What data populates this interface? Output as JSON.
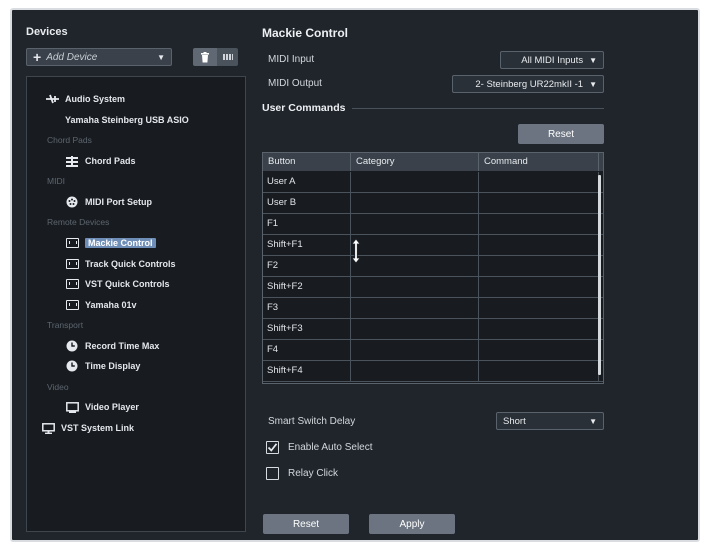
{
  "devices_panel": {
    "title": "Devices",
    "add_device_placeholder": "Add Device",
    "tree": [
      {
        "type": "item",
        "label": "Audio System",
        "icon": "audio-system-icon"
      },
      {
        "type": "item",
        "label": "Yamaha Steinberg USB ASIO",
        "icon": "none",
        "sub": true
      },
      {
        "type": "category",
        "label": "Chord Pads"
      },
      {
        "type": "item",
        "label": "Chord Pads",
        "icon": "chord-pads-icon"
      },
      {
        "type": "category",
        "label": "MIDI"
      },
      {
        "type": "item",
        "label": "MIDI Port Setup",
        "icon": "midi-port-icon"
      },
      {
        "type": "category",
        "label": "Remote Devices"
      },
      {
        "type": "item",
        "label": "Mackie Control",
        "icon": "midi-device-icon",
        "selected": true
      },
      {
        "type": "item",
        "label": "Track Quick Controls",
        "icon": "midi-device-icon"
      },
      {
        "type": "item",
        "label": "VST Quick Controls",
        "icon": "midi-device-icon"
      },
      {
        "type": "item",
        "label": "Yamaha 01v",
        "icon": "midi-device-icon"
      },
      {
        "type": "category",
        "label": "Transport"
      },
      {
        "type": "item",
        "label": "Record Time Max",
        "icon": "clock-icon"
      },
      {
        "type": "item",
        "label": "Time Display",
        "icon": "clock-icon"
      },
      {
        "type": "category",
        "label": "Video"
      },
      {
        "type": "item",
        "label": "Video Player",
        "icon": "video-player-icon"
      },
      {
        "type": "item",
        "label": "VST System Link",
        "icon": "monitor-icon",
        "root": true
      }
    ]
  },
  "device_panel": {
    "title": "Mackie Control",
    "midi_input_label": "MIDI Input",
    "midi_input_value": "All MIDI Inputs",
    "midi_output_label": "MIDI Output",
    "midi_output_value": "2- Steinberg UR22mkII -1",
    "user_commands_title": "User Commands",
    "reset_top_label": "Reset",
    "table": {
      "headers": [
        "Button",
        "Category",
        "Command"
      ],
      "rows": [
        [
          "User A",
          "",
          ""
        ],
        [
          "User B",
          "",
          ""
        ],
        [
          "F1",
          "",
          ""
        ],
        [
          "Shift+F1",
          "",
          ""
        ],
        [
          "F2",
          "",
          ""
        ],
        [
          "Shift+F2",
          "",
          ""
        ],
        [
          "F3",
          "",
          ""
        ],
        [
          "Shift+F3",
          "",
          ""
        ],
        [
          "F4",
          "",
          ""
        ],
        [
          "Shift+F4",
          "",
          ""
        ]
      ]
    },
    "smart_switch_label": "Smart Switch Delay",
    "smart_switch_value": "Short",
    "enable_auto_select_label": "Enable Auto Select",
    "enable_auto_select_checked": true,
    "relay_click_label": "Relay Click",
    "relay_click_checked": false,
    "reset_label": "Reset",
    "apply_label": "Apply"
  },
  "colors": {
    "background": "#20252b",
    "tree_background": "#181c21",
    "selection": "#6e8db7",
    "button": "#6b7480"
  }
}
